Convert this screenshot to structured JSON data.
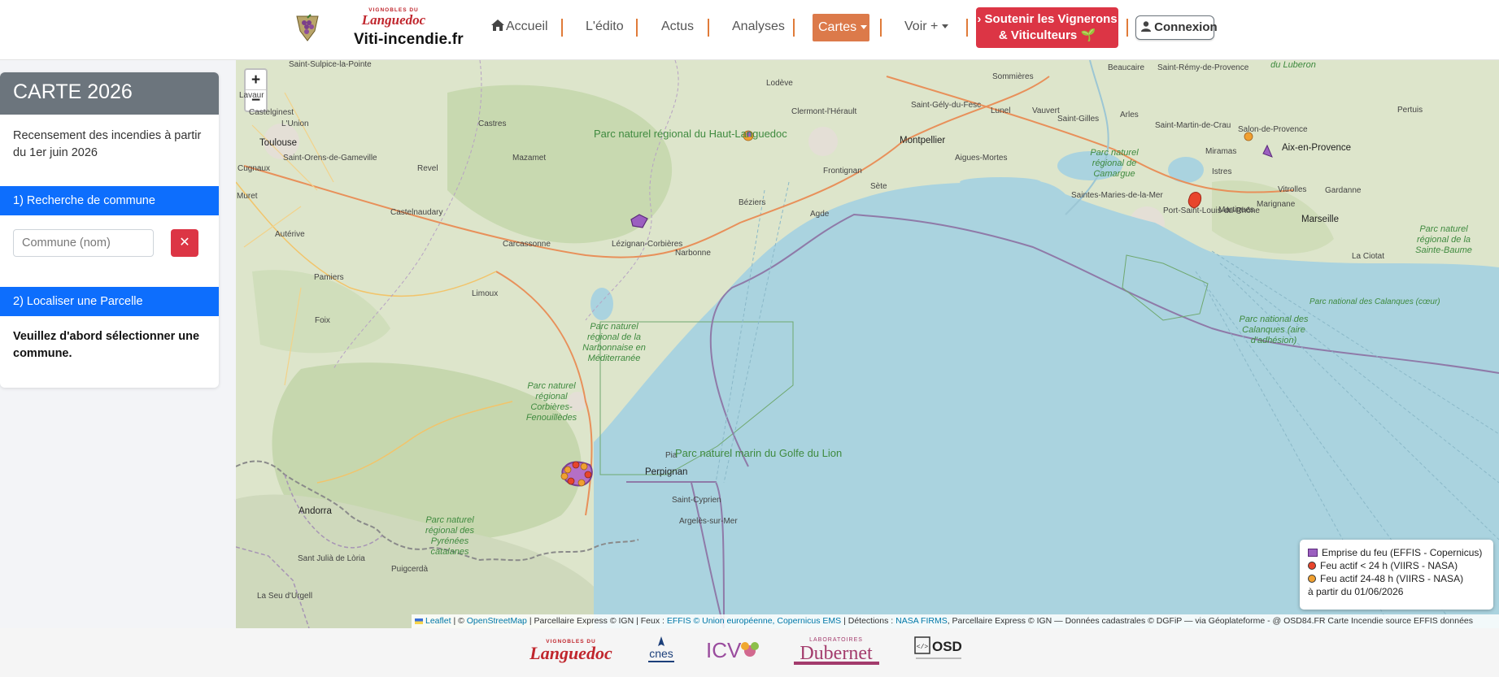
{
  "nav": {
    "logo_text": "VIGNOBLES DU Languedoc",
    "site_name": "Viti-incendie.fr",
    "items": [
      {
        "label": "Accueil"
      },
      {
        "label": "L'édito"
      },
      {
        "label": "Actus"
      },
      {
        "label": "Analyses"
      },
      {
        "label": "Cartes"
      },
      {
        "label": "Voir +"
      }
    ],
    "support_line1": "Soutenir les Vignerons",
    "support_line2": "& Viticulteurs 🌱",
    "login_label": "Connexion",
    "colors": {
      "active_tab": "#dc7a4a",
      "separator": "#e07b39",
      "support": "#dc3545"
    }
  },
  "sidebar": {
    "title": "CARTE 2026",
    "intro": "Recensement des incendies à partir du 1er juin 2026",
    "section1": "1) Recherche de commune",
    "search_placeholder": "Commune (nom)",
    "clear_symbol": "✕",
    "section2": "2) Localiser une Parcelle",
    "warning": "Veuillez d'abord sélectionner une commune."
  },
  "map": {
    "zoom_in": "+",
    "zoom_out": "−",
    "cities": {
      "toulouse": "Toulouse",
      "montpellier": "Montpellier",
      "marseille": "Marseille",
      "perpignan": "Perpignan",
      "andorra": "Andorra",
      "aix": "Aix-en-Provence",
      "narbonne": "Narbonne",
      "beziers": "Béziers",
      "carcassonne": "Carcassonne",
      "sete": "Sète",
      "agde": "Agde"
    },
    "towns": [
      "Saint-Sulpice-la-Pointe",
      "Lavaur",
      "Castres",
      "Mazamet",
      "Revel",
      "Lodève",
      "Clermont-l'Hérault",
      "Castelnaudary",
      "Lézignan-Corbières",
      "Limoux",
      "Pamiers",
      "Foix",
      "Saint-Cyprien",
      "Argelès-sur-Mer",
      "Frontignan",
      "Aigues-Mortes",
      "Lunel",
      "Saintes-Maries-de-la-Mer",
      "Beaucaire",
      "Saint-Rémy-de-Provence",
      "Arles",
      "Istres",
      "Martigues",
      "Vitrolles",
      "La Ciotat",
      "Saint-Gély-du-Fesc",
      "Salon-de-Provence",
      "Miramas",
      "Pertuis",
      "Port-Saint-Louis-du-Rhône",
      "Marignane",
      "Gardanne",
      "Puigcerdà",
      "Sant Julià de Lòria",
      "La Seu d'Urgell",
      "Muret",
      "Castelginest",
      "L'Union",
      "Saint-Orens-de-Gameville",
      "Cugnaux",
      "Autérive",
      "Vauvert",
      "Saint-Gilles",
      "Sommières",
      "Pia",
      "Saint-Martin-de-Crau"
    ],
    "parks": {
      "haut_languedoc": "Parc naturel régional du Haut-Languedoc",
      "narbonnaise": "Parc naturel régional de la Narbonnaise en Méditerranée",
      "corbieres": "Parc naturel régional Corbières-Fenouillèdes",
      "pyrenees": "Parc naturel régional des Pyrénées catalanes",
      "camargue": "Parc naturel régional de Camargue",
      "calanques": "Parc national des Calanques (aire d'adhésion)",
      "calanques_coeur": "Parc national des Calanques (cœur)",
      "sainte_baume": "Parc naturel régional de la Sainte-Baume",
      "marin": "Parc naturel marin du Golfe du Lion",
      "luberon": "du Luberon"
    },
    "legend": {
      "burned_area": "Emprise du feu (EFFIS - Copernicus)",
      "active_24": "Feu actif < 24 h (VIIRS - NASA)",
      "active_48": "Feu actif 24-48 h (VIIRS - NASA)",
      "since": "à partir du 01/06/2026",
      "colors": {
        "burned": "#9b5fc0",
        "active_24": "#e8452c",
        "active_48": "#f0a030"
      }
    },
    "attribution": {
      "leaflet": "Leaflet",
      "osm_prefix": "| ©",
      "osm": "OpenStreetMap",
      "mid1": "| Parcellaire Express © IGN | Feux :",
      "effis": "EFFIS © Union européenne, Copernicus EMS",
      "mid2": "| Détections :",
      "firms": "NASA FIRMS",
      "tail": ", Parcellaire Express © IGN — Données cadastrales © DGFiP — via Géoplateforme - @ OSD84.FR Carte Incendie source EFFIS données"
    }
  },
  "footer": {
    "logos": [
      "Vignobles du Languedoc",
      "CNES",
      "Groupe ICV",
      "Laboratoires Dubernet",
      "OSD"
    ],
    "cnes_text": "cnes",
    "icv_text": "ICV",
    "dubernet_top": "LABORATOIRES",
    "dubernet_text": "Dubernet",
    "osd_text": "OSD"
  }
}
